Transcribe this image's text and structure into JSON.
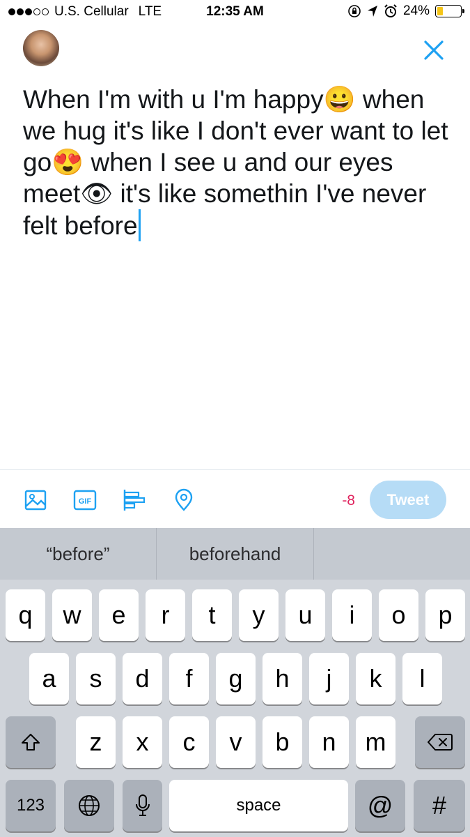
{
  "status_bar": {
    "carrier": "U.S. Cellular",
    "network": "LTE",
    "time": "12:35 AM",
    "battery": "24%",
    "battery_level": 0.24,
    "signal_bars": 3,
    "signal_bars_total": 5
  },
  "compose": {
    "text": "When I'm with u I'm happy😀 when we hug it's like I don't ever want to let go😍 when I see u and our eyes meet👁 it's like somethin I've never felt before"
  },
  "toolbar": {
    "icons": [
      "image-icon",
      "gif-icon",
      "poll-icon",
      "location-icon"
    ],
    "gif_label": "GIF",
    "char_count": "-8",
    "tweet_label": "Tweet"
  },
  "keyboard": {
    "predictions": [
      "“before”",
      "beforehand",
      ""
    ],
    "row1": [
      "q",
      "w",
      "e",
      "r",
      "t",
      "y",
      "u",
      "i",
      "o",
      "p"
    ],
    "row2": [
      "a",
      "s",
      "d",
      "f",
      "g",
      "h",
      "j",
      "k",
      "l"
    ],
    "row3": [
      "z",
      "x",
      "c",
      "v",
      "b",
      "n",
      "m"
    ],
    "numbers_label": "123",
    "space_label": "space",
    "at_label": "@",
    "hash_label": "#"
  },
  "colors": {
    "accent": "#1da1f2",
    "tweet_button_disabled": "#b6dcf6",
    "count_negative": "#e0245e",
    "keyboard_bg": "#d1d5db"
  }
}
